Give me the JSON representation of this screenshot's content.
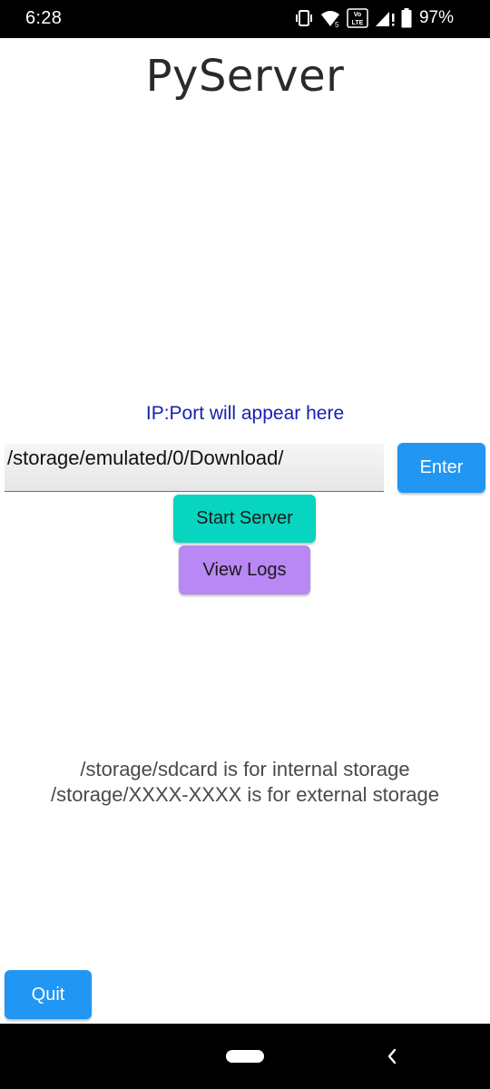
{
  "status_bar": {
    "time": "6:28",
    "battery": "97%",
    "icons": [
      "vibrate-icon",
      "wifi-icon",
      "volte-icon",
      "signal-icon",
      "battery-icon"
    ]
  },
  "app": {
    "title": "PyServer"
  },
  "main": {
    "ip_label": "IP:Port will appear here",
    "path_value": "/storage/emulated/0/Download/",
    "enter_label": "Enter",
    "start_label": "Start Server",
    "logs_label": "View Logs",
    "storage_line1": "/storage/sdcard is for internal storage",
    "storage_line2": "/storage/XXXX-XXXX is for external storage",
    "quit_label": "Quit"
  },
  "colors": {
    "enter_button": "#2196f3",
    "start_button": "#08d5bf",
    "logs_button": "#b988f4",
    "quit_button": "#2196f3",
    "ip_label": "#1522b4"
  },
  "nav_bar": {
    "icons": [
      "home-pill-icon",
      "back-icon"
    ]
  }
}
